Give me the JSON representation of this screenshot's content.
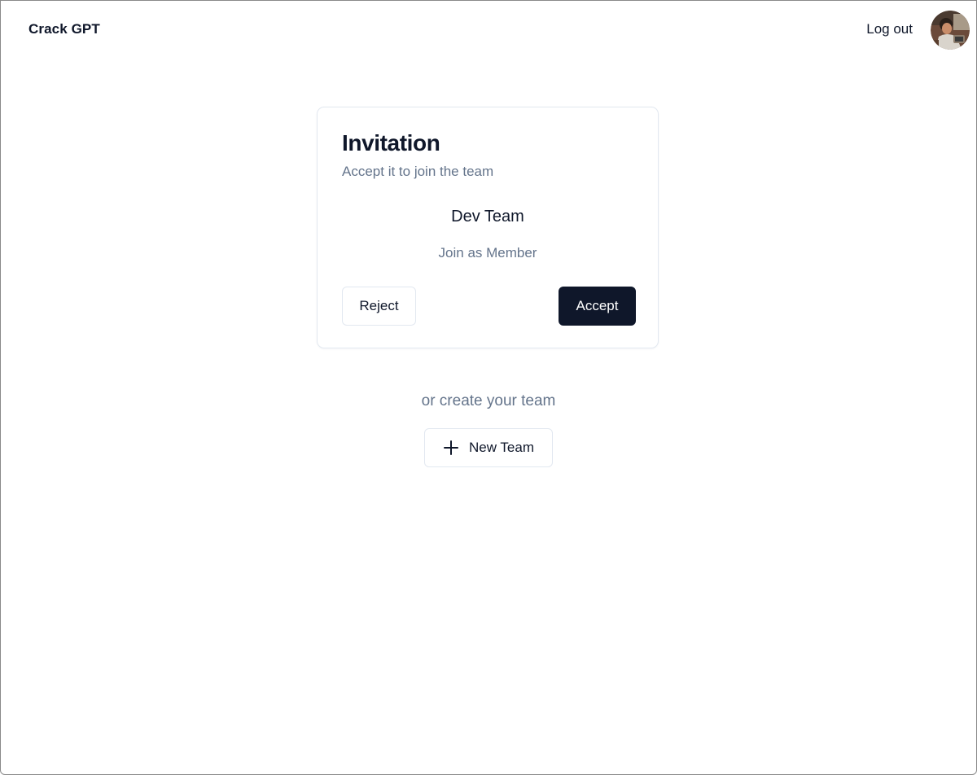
{
  "header": {
    "brand": "Crack GPT",
    "logout_label": "Log out",
    "avatar_icon": "user-avatar"
  },
  "invitation": {
    "title": "Invitation",
    "subtitle": "Accept it to join the team",
    "team_name": "Dev Team",
    "role_text": "Join as Member",
    "reject_label": "Reject",
    "accept_label": "Accept"
  },
  "create": {
    "prompt": "or create your team",
    "new_team_label": "New Team",
    "new_team_icon": "plus-icon"
  },
  "colors": {
    "primary": "#0f172a",
    "muted_text": "#64748b",
    "border": "#e2e8f0",
    "background": "#ffffff"
  }
}
